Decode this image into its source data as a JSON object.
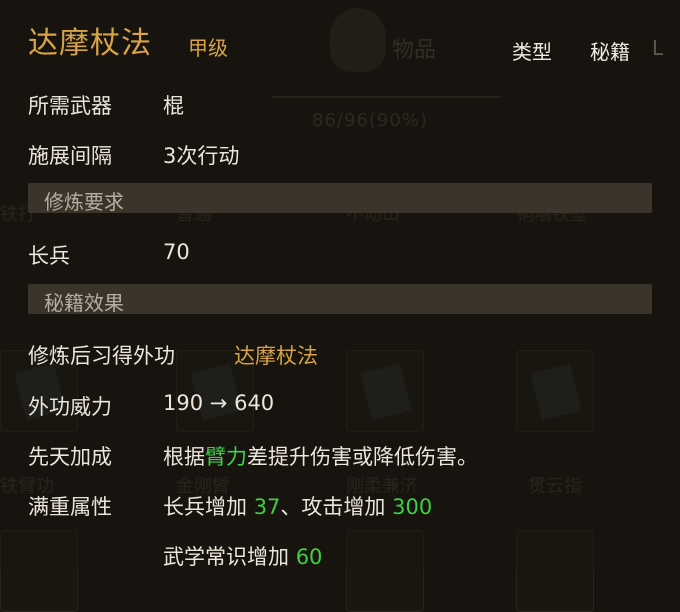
{
  "background": {
    "inventory_label": "物品",
    "capacity": "86/96(90%)",
    "row_labels": [
      "铁打",
      "普通",
      "不动山",
      "铜墙铁壁"
    ],
    "slot_names": [
      "铁臂功",
      "金刚臂",
      "刚柔兼济",
      "贯云指"
    ]
  },
  "header": {
    "title": "达摩杖法",
    "grade": "甲级",
    "type_label": "类型",
    "type_value": "秘籍",
    "close_hint": "L"
  },
  "basic": {
    "weapon_label": "所需武器",
    "weapon_value": "棍",
    "interval_label": "施展间隔",
    "interval_value": "3次行动"
  },
  "requirements": {
    "section_title": "修炼要求",
    "req_label": "长兵",
    "req_value": "70"
  },
  "effects": {
    "section_title": "秘籍效果",
    "learn_label": "修炼后习得外功",
    "learn_value": "达摩杖法",
    "power_label": "外功威力",
    "power_from": "190",
    "power_arrow": "→",
    "power_to": "640",
    "innate_label": "先天加成",
    "innate_prefix": "根据",
    "innate_stat": "臂力",
    "innate_suffix": "差提升伤害或降低伤害。",
    "full_label": "满重属性",
    "full_bonus1_text": "长兵增加",
    "full_bonus1_value": "37",
    "full_sep": "、",
    "full_bonus2_text": "攻击增加",
    "full_bonus2_value": "300",
    "full_bonus3_text": "武学常识增加",
    "full_bonus3_value": "60"
  },
  "colors": {
    "gold": "#d8a445",
    "green": "#3fd14a",
    "panel": "#3a342b"
  }
}
